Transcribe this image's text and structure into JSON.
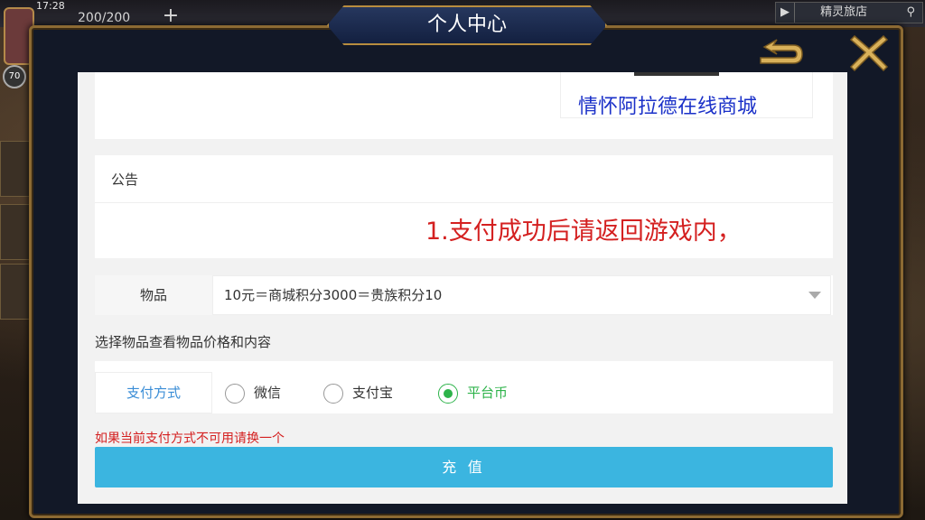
{
  "game": {
    "time": "17:28",
    "energy": "200/200",
    "level": "70",
    "shop_label": "精灵旅店"
  },
  "dialog": {
    "title": "个人中心"
  },
  "banner": {
    "link_text": "情怀阿拉德在线商城"
  },
  "notice": {
    "title": "公告",
    "text": "1.支付成功后请返回游戏内，"
  },
  "item": {
    "label": "物品",
    "selected": "10元＝商城积分3000＝贵族积分10",
    "hint": "选择物品查看物品价格和内容"
  },
  "payment": {
    "label": "支付方式",
    "options": [
      {
        "label": "微信",
        "selected": false
      },
      {
        "label": "支付宝",
        "selected": false
      },
      {
        "label": "平台币",
        "selected": true
      }
    ],
    "warning": "如果当前支付方式不可用请换一个"
  },
  "actions": {
    "recharge": "充 值"
  },
  "colors": {
    "accent": "#3bb5e0",
    "selected_green": "#2db34a",
    "warning_red": "#d42020",
    "link_blue": "#1a30c8",
    "frame_gold": "#b88d3f"
  }
}
